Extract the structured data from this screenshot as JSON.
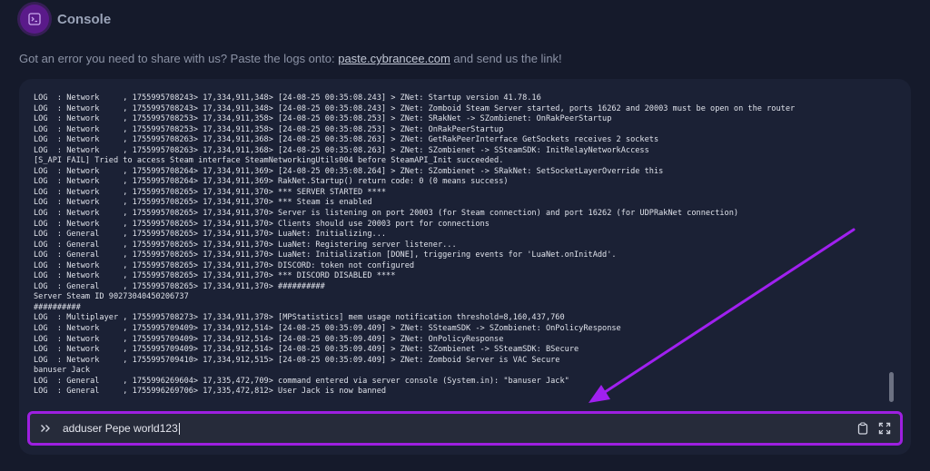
{
  "header": {
    "title": "Console",
    "icon": "terminal-icon"
  },
  "info": {
    "text_before": "Got an error you need to share with us? Paste the logs onto: ",
    "link_text": "paste.cybrancee.com",
    "text_after": " and send us the link!"
  },
  "log_lines": [
    "LOG  : Network     , 1755995708243> 17,334,911,348> [24-08-25 00:35:08.243] > ZNet: Startup version 41.78.16",
    "LOG  : Network     , 1755995708243> 17,334,911,348> [24-08-25 00:35:08.243] > ZNet: Zomboid Steam Server started, ports 16262 and 20003 must be open on the router",
    "LOG  : Network     , 1755995708253> 17,334,911,358> [24-08-25 00:35:08.253] > ZNet: SRakNet -> SZombienet: OnRakPeerStartup",
    "LOG  : Network     , 1755995708253> 17,334,911,358> [24-08-25 00:35:08.253] > ZNet: OnRakPeerStartup",
    "LOG  : Network     , 1755995708263> 17,334,911,368> [24-08-25 00:35:08.263] > ZNet: GetRakPeerInterface GetSockets receives 2 sockets",
    "LOG  : Network     , 1755995708263> 17,334,911,368> [24-08-25 00:35:08.263] > ZNet: SZombienet -> SSteamSDK: InitRelayNetworkAccess",
    "[S_API FAIL] Tried to access Steam interface SteamNetworkingUtils004 before SteamAPI_Init succeeded.",
    "LOG  : Network     , 1755995708264> 17,334,911,369> [24-08-25 00:35:08.264] > ZNet: SZombienet -> SRakNet: SetSocketLayerOverride this",
    "LOG  : Network     , 1755995708264> 17,334,911,369> RakNet.Startup() return code: 0 (0 means success)",
    "LOG  : Network     , 1755995708265> 17,334,911,370> *** SERVER STARTED ****",
    "LOG  : Network     , 1755995708265> 17,334,911,370> *** Steam is enabled",
    "LOG  : Network     , 1755995708265> 17,334,911,370> Server is listening on port 20003 (for Steam connection) and port 16262 (for UDPRakNet connection)",
    "LOG  : Network     , 1755995708265> 17,334,911,370> Clients should use 20003 port for connections",
    "LOG  : General     , 1755995708265> 17,334,911,370> LuaNet: Initializing...",
    "LOG  : General     , 1755995708265> 17,334,911,370> LuaNet: Registering server listener...",
    "LOG  : General     , 1755995708265> 17,334,911,370> LuaNet: Initialization [DONE], triggering events for 'LuaNet.onInitAdd'.",
    "LOG  : Network     , 1755995708265> 17,334,911,370> DISCORD: token not configured",
    "LOG  : Network     , 1755995708265> 17,334,911,370> *** DISCORD DISABLED ****",
    "LOG  : General     , 1755995708265> 17,334,911,370> ##########",
    "Server Steam ID 90273040450206737",
    "##########",
    "LOG  : Multiplayer , 1755995708273> 17,334,911,378> [MPStatistics] mem usage notification threshold=8,160,437,760",
    "LOG  : Network     , 1755995709409> 17,334,912,514> [24-08-25 00:35:09.409] > ZNet: SSteamSDK -> SZombienet: OnPolicyResponse",
    "LOG  : Network     , 1755995709409> 17,334,912,514> [24-08-25 00:35:09.409] > ZNet: OnPolicyResponse",
    "LOG  : Network     , 1755995709409> 17,334,912,514> [24-08-25 00:35:09.409] > ZNet: SZombienet -> SSteamSDK: BSecure",
    "LOG  : Network     , 1755995709410> 17,334,912,515> [24-08-25 00:35:09.409] > ZNet: Zomboid Server is VAC Secure",
    "banuser Jack",
    "LOG  : General     , 1755996269604> 17,335,472,709> command entered via server console (System.in): \"banuser Jack\"",
    "LOG  : General     , 1755996269706> 17,335,472,812> User Jack is now banned"
  ],
  "command": {
    "value": "adduser Pepe world123",
    "prompt_icon": "chevrons-right-icon"
  },
  "tools": {
    "copy_icon": "clipboard-icon",
    "expand_icon": "expand-icon"
  },
  "colors": {
    "accent": "#9d1fe0",
    "arrow": "#a020f0"
  }
}
